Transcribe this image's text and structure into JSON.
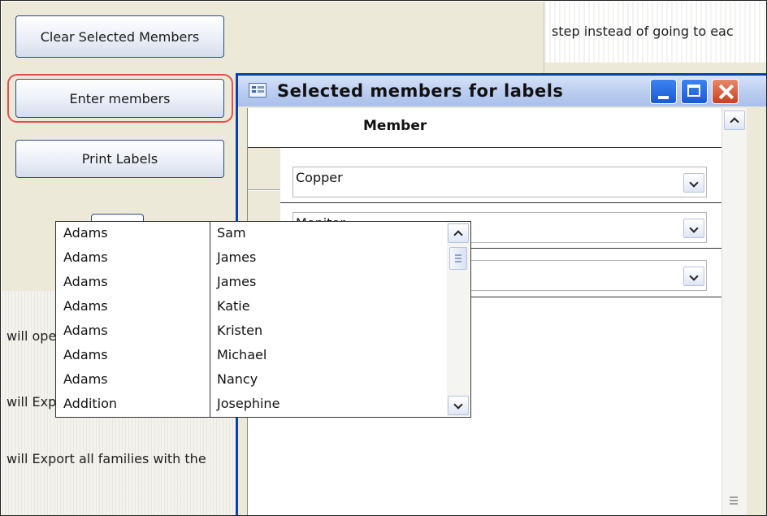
{
  "left_panel": {
    "buttons": {
      "clear": "Clear Selected Members",
      "enter": "Enter members",
      "print": "Print Labels"
    },
    "exit_icon": "door-exit-icon"
  },
  "right_panel": {
    "top_text": "step instead of going to eac"
  },
  "bottom_panel": {
    "lines": [
      "will open a form that allows yo",
      "will Export all families with the",
      "will Export all families with the"
    ]
  },
  "dialog": {
    "title": "Selected members for labels",
    "icon": "form-icon",
    "controls": [
      "minimize",
      "maximize",
      "close"
    ],
    "column_header": "Member",
    "rows": [
      {
        "value": "Copper"
      },
      {
        "value": "Monitor"
      },
      {
        "value": ""
      }
    ],
    "dropdown": {
      "items": [
        {
          "last": "Adams",
          "first": "Sam"
        },
        {
          "last": "Adams",
          "first": "James"
        },
        {
          "last": "Adams",
          "first": "James"
        },
        {
          "last": "Adams",
          "first": "Katie"
        },
        {
          "last": "Adams",
          "first": "Kristen"
        },
        {
          "last": "Adams",
          "first": "Michael"
        },
        {
          "last": "Adams",
          "first": "Nancy"
        },
        {
          "last": "Addition",
          "first": "Josephine"
        }
      ]
    }
  }
}
